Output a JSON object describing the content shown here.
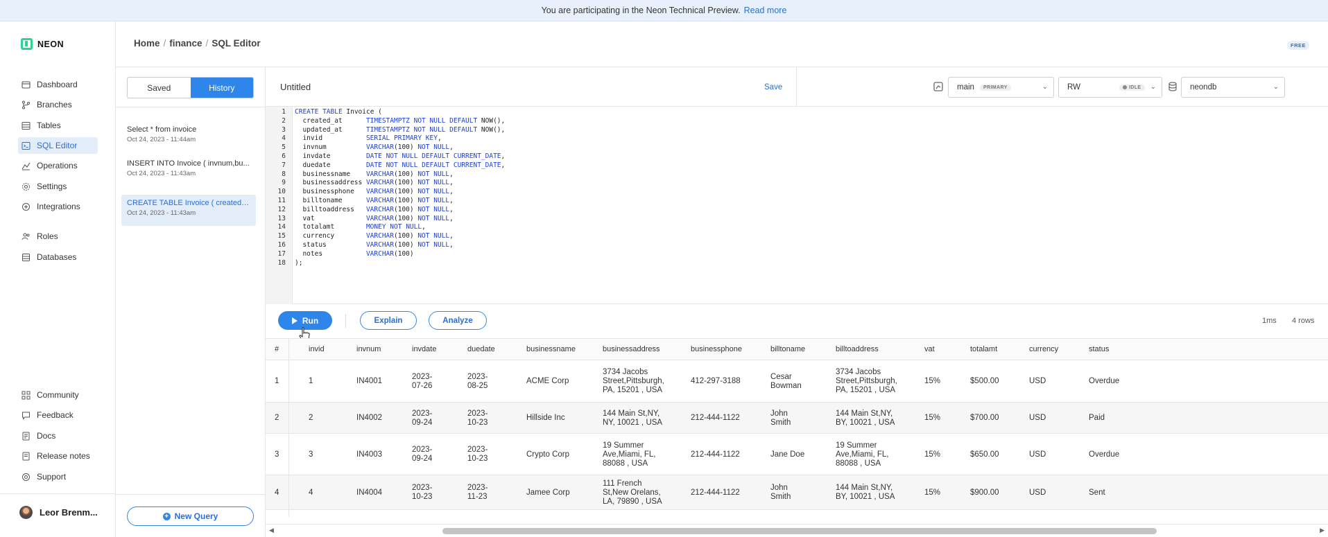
{
  "banner": {
    "text": "You are participating in the Neon Technical Preview.",
    "link": "Read more"
  },
  "app": {
    "logo_text": "NEON"
  },
  "nav": {
    "main": [
      {
        "label": "Dashboard",
        "icon": "dashboard-icon"
      },
      {
        "label": "Branches",
        "icon": "branches-icon"
      },
      {
        "label": "Tables",
        "icon": "tables-icon"
      },
      {
        "label": "SQL Editor",
        "icon": "sql-editor-icon",
        "active": true
      },
      {
        "label": "Operations",
        "icon": "operations-icon"
      },
      {
        "label": "Settings",
        "icon": "settings-icon"
      },
      {
        "label": "Integrations",
        "icon": "integrations-icon"
      },
      {
        "label": "Roles",
        "icon": "roles-icon"
      },
      {
        "label": "Databases",
        "icon": "databases-icon"
      }
    ],
    "footer": [
      {
        "label": "Community",
        "icon": "community-icon"
      },
      {
        "label": "Feedback",
        "icon": "feedback-icon"
      },
      {
        "label": "Docs",
        "icon": "docs-icon"
      },
      {
        "label": "Release notes",
        "icon": "release-notes-icon"
      },
      {
        "label": "Support",
        "icon": "support-icon"
      }
    ],
    "user": "Leor Brenm..."
  },
  "header": {
    "breadcrumb": [
      "Home",
      "finance",
      "SQL Editor"
    ],
    "plan_badge": "FREE"
  },
  "history": {
    "tabs": [
      "Saved",
      "History"
    ],
    "active_tab": "History",
    "items": [
      {
        "query": "Select * from invoice",
        "date": "Oct 24, 2023 - 11:44am"
      },
      {
        "query": "INSERT INTO Invoice ( invnum,bu...",
        "date": "Oct 24, 2023 - 11:43am"
      },
      {
        "query": "CREATE TABLE Invoice ( created_...",
        "date": "Oct 24, 2023 - 11:43am",
        "selected": true
      }
    ],
    "new_query": "New Query"
  },
  "query": {
    "title": "Untitled",
    "save": "Save",
    "branch": "main",
    "branch_badge": "PRIMARY",
    "compute": "RW",
    "compute_status": "IDLE",
    "database": "neondb"
  },
  "editor": {
    "lines": [
      "CREATE TABLE Invoice (",
      "  created_at      TIMESTAMPTZ NOT NULL DEFAULT NOW(),",
      "  updated_at      TIMESTAMPTZ NOT NULL DEFAULT NOW(),",
      "  invid           SERIAL PRIMARY KEY,",
      "  invnum          VARCHAR(100) NOT NULL,",
      "  invdate         DATE NOT NULL DEFAULT CURRENT_DATE,",
      "  duedate         DATE NOT NULL DEFAULT CURRENT_DATE,",
      "  businessname    VARCHAR(100) NOT NULL,",
      "  businessaddress VARCHAR(100) NOT NULL,",
      "  businessphone   VARCHAR(100) NOT NULL,",
      "  billtoname      VARCHAR(100) NOT NULL,",
      "  billtoaddress   VARCHAR(100) NOT NULL,",
      "  vat             VARCHAR(100) NOT NULL,",
      "  totalamt        MONEY NOT NULL,",
      "  currency        VARCHAR(100) NOT NULL,",
      "  status          VARCHAR(100) NOT NULL,",
      "  notes           VARCHAR(100)",
      ");"
    ]
  },
  "toolbar": {
    "run": "Run",
    "explain": "Explain",
    "analyze": "Analyze",
    "time": "1ms",
    "rows": "4 rows"
  },
  "results": {
    "columns": [
      "#",
      "invid",
      "invnum",
      "invdate",
      "duedate",
      "businessname",
      "businessaddress",
      "businessphone",
      "billtoname",
      "billtoaddress",
      "vat",
      "totalamt",
      "currency",
      "status"
    ],
    "rows": [
      {
        "n": "1",
        "invid": "1",
        "invnum": "IN4001",
        "invdate": "2023-\n07-26",
        "duedate": "2023-\n08-25",
        "businessname": "ACME Corp",
        "businessaddress": "3734 Jacobs\nStreet,Pittsburgh,\nPA, 15201 , USA",
        "businessphone": "412-297-3188",
        "billtoname": "Cesar\nBowman",
        "billtoaddress": "3734 Jacobs\nStreet,Pittsburgh,\nPA, 15201 , USA",
        "vat": "15%",
        "totalamt": "$500.00",
        "currency": "USD",
        "status": "Overdue"
      },
      {
        "n": "2",
        "invid": "2",
        "invnum": "IN4002",
        "invdate": "2023-\n09-24",
        "duedate": "2023-\n10-23",
        "businessname": "Hillside Inc",
        "businessaddress": "144 Main St,NY,\nNY, 10021 , USA",
        "businessphone": "212-444-1122",
        "billtoname": "John\nSmith",
        "billtoaddress": "144 Main St,NY,\nBY, 10021 , USA",
        "vat": "15%",
        "totalamt": "$700.00",
        "currency": "USD",
        "status": "Paid"
      },
      {
        "n": "3",
        "invid": "3",
        "invnum": "IN4003",
        "invdate": "2023-\n09-24",
        "duedate": "2023-\n10-23",
        "businessname": "Crypto Corp",
        "businessaddress": "19 Summer\nAve,Miami, FL,\n88088 , USA",
        "businessphone": "212-444-1122",
        "billtoname": "Jane Doe",
        "billtoaddress": "19 Summer\nAve,Miami, FL,\n88088 , USA",
        "vat": "15%",
        "totalamt": "$650.00",
        "currency": "USD",
        "status": "Overdue"
      },
      {
        "n": "4",
        "invid": "4",
        "invnum": "IN4004",
        "invdate": "2023-\n10-23",
        "duedate": "2023-\n11-23",
        "businessname": "Jamee Corp",
        "businessaddress": "111 French\nSt,New Orelans,\nLA, 79890 , USA",
        "businessphone": "212-444-1122",
        "billtoname": "John\nSmith",
        "billtoaddress": "144 Main St,NY,\nBY, 10021 , USA",
        "vat": "15%",
        "totalamt": "$900.00",
        "currency": "USD",
        "status": "Sent"
      }
    ]
  },
  "colors": {
    "accent": "#2f86ea",
    "brand": "#2bd48f",
    "banner_bg": "#e8f0fb",
    "sql_keyword": "#1d40d8"
  }
}
